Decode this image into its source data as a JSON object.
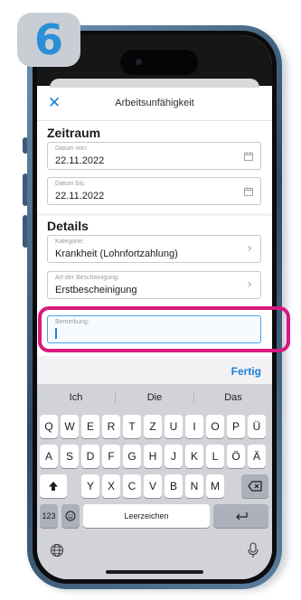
{
  "step_badge": "6",
  "nav": {
    "close_icon": "close-icon",
    "title": "Arbeitsunfähigkeit"
  },
  "zeitraum": {
    "title": "Zeitraum",
    "from": {
      "label": "Datum von:",
      "value": "22.11.2022",
      "icon": "calendar-icon"
    },
    "to": {
      "label": "Datum bis:",
      "value": "22.11.2022",
      "icon": "calendar-icon"
    }
  },
  "details": {
    "title": "Details",
    "category": {
      "label": "Kategorie:",
      "value": "Krankheit (Lohnfortzahlung)"
    },
    "certificate": {
      "label": "Art der Bescheinigung:",
      "value": "Erstbescheinigung"
    },
    "remark": {
      "label": "Bemerkung:",
      "value": ""
    }
  },
  "done_label": "Fertig",
  "keyboard": {
    "suggestions": [
      "Ich",
      "Die",
      "Das"
    ],
    "row1": [
      "Q",
      "W",
      "E",
      "R",
      "T",
      "Z",
      "U",
      "I",
      "O",
      "P",
      "Ü"
    ],
    "row2": [
      "A",
      "S",
      "D",
      "F",
      "G",
      "H",
      "J",
      "K",
      "L",
      "Ö",
      "Ä"
    ],
    "row3": [
      "Y",
      "X",
      "C",
      "V",
      "B",
      "N",
      "M"
    ],
    "numbers_key": "123",
    "space_label": "Leerzeichen",
    "shift_icon": "shift-icon",
    "backspace_icon": "backspace-icon",
    "emoji_icon": "emoji-icon",
    "return_icon": "return-icon",
    "globe_icon": "globe-icon",
    "mic_icon": "microphone-icon"
  },
  "colors": {
    "accent": "#1f7fd6",
    "highlight": "#d8197e",
    "badge_number": "#2a8fd6"
  }
}
